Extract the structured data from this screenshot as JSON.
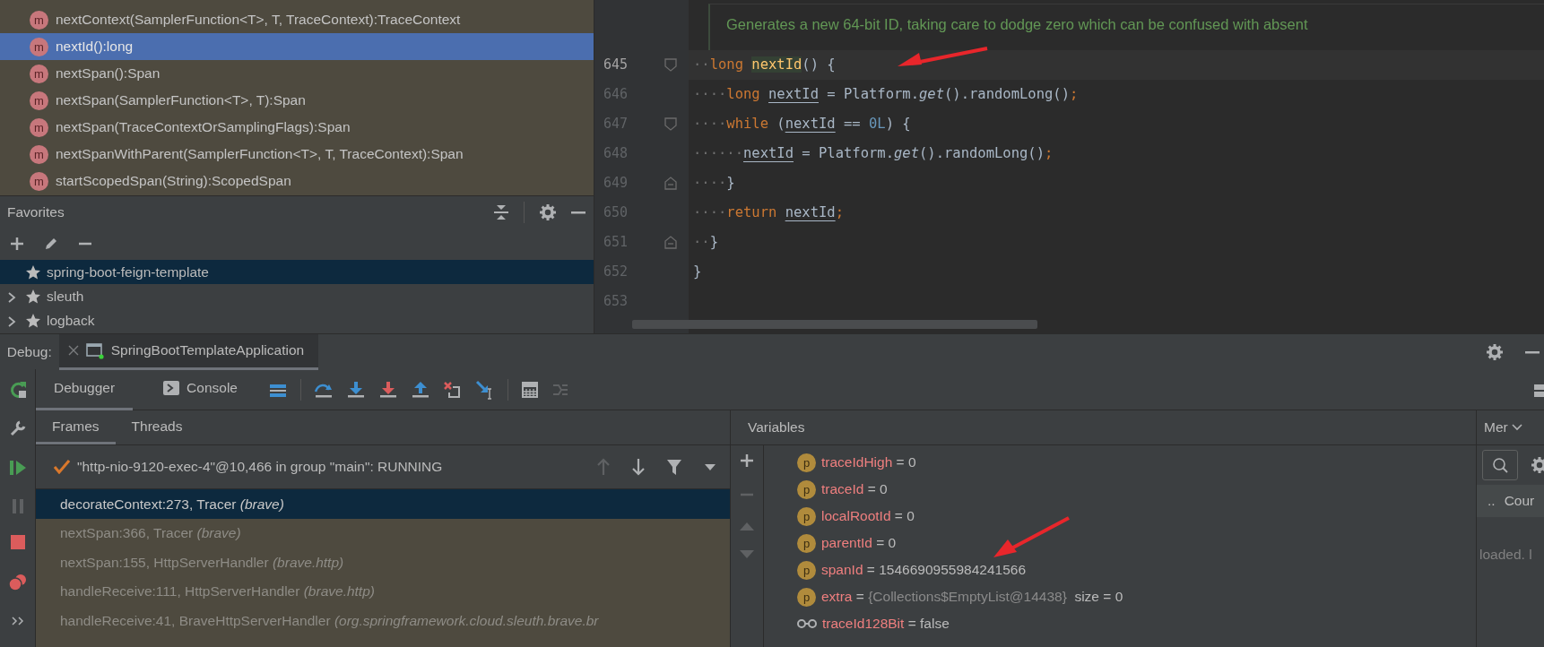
{
  "structure": {
    "items": [
      {
        "icon": "m",
        "label": "nextContext(SamplerFunction<T>, T, TraceContext):TraceContext",
        "selected": false
      },
      {
        "icon": "m",
        "label": "nextId():long",
        "selected": true
      },
      {
        "icon": "m",
        "label": "nextSpan():Span",
        "selected": false
      },
      {
        "icon": "m",
        "label": "nextSpan(SamplerFunction<T>, T):Span",
        "selected": false
      },
      {
        "icon": "m",
        "label": "nextSpan(TraceContextOrSamplingFlags):Span",
        "selected": false
      },
      {
        "icon": "m",
        "label": "nextSpanWithParent(SamplerFunction<T>, T, TraceContext):Span",
        "selected": false
      },
      {
        "icon": "m",
        "label": "startScopedSpan(String):ScopedSpan",
        "selected": false
      }
    ]
  },
  "favorites": {
    "title": "Favorites",
    "items": [
      {
        "label": "spring-boot-feign-template",
        "expandable": false,
        "selected": true
      },
      {
        "label": "sleuth",
        "expandable": true,
        "selected": false
      },
      {
        "label": "logback",
        "expandable": true,
        "selected": false
      }
    ]
  },
  "editor": {
    "doc_comment": "Generates a new 64-bit ID, taking care to dodge zero which can be confused with absent",
    "lines": [
      {
        "number": "645",
        "current": true,
        "fold_start": true,
        "fold_end": false,
        "tokens": [
          {
            "kind": "ws",
            "text": "··"
          },
          {
            "kind": "kw",
            "text": "long "
          },
          {
            "kind": "decl",
            "text": "nextId"
          },
          {
            "kind": "plain",
            "text": "() {"
          }
        ]
      },
      {
        "number": "646",
        "current": false,
        "fold_start": false,
        "fold_end": false,
        "tokens": [
          {
            "kind": "ws",
            "text": "····"
          },
          {
            "kind": "kw",
            "text": "long "
          },
          {
            "kind": "local",
            "text": "nextId"
          },
          {
            "kind": "plain",
            "text": " = Platform."
          },
          {
            "kind": "italic",
            "text": "get"
          },
          {
            "kind": "plain",
            "text": "().randomLong()"
          },
          {
            "kind": "kw",
            "text": ";"
          }
        ]
      },
      {
        "number": "647",
        "current": false,
        "fold_start": true,
        "fold_end": false,
        "tokens": [
          {
            "kind": "ws",
            "text": "····"
          },
          {
            "kind": "kw",
            "text": "while"
          },
          {
            "kind": "plain",
            "text": " ("
          },
          {
            "kind": "local",
            "text": "nextId"
          },
          {
            "kind": "plain",
            "text": " == "
          },
          {
            "kind": "num",
            "text": "0L"
          },
          {
            "kind": "plain",
            "text": ") {"
          }
        ]
      },
      {
        "number": "648",
        "current": false,
        "fold_start": false,
        "fold_end": false,
        "tokens": [
          {
            "kind": "ws",
            "text": "······"
          },
          {
            "kind": "local",
            "text": "nextId"
          },
          {
            "kind": "plain",
            "text": " = Platform."
          },
          {
            "kind": "italic",
            "text": "get"
          },
          {
            "kind": "plain",
            "text": "().randomLong()"
          },
          {
            "kind": "kw",
            "text": ";"
          }
        ]
      },
      {
        "number": "649",
        "current": false,
        "fold_start": false,
        "fold_end": true,
        "tokens": [
          {
            "kind": "ws",
            "text": "····"
          },
          {
            "kind": "plain",
            "text": "}"
          }
        ]
      },
      {
        "number": "650",
        "current": false,
        "fold_start": false,
        "fold_end": false,
        "tokens": [
          {
            "kind": "ws",
            "text": "····"
          },
          {
            "kind": "kw",
            "text": "return "
          },
          {
            "kind": "local",
            "text": "nextId"
          },
          {
            "kind": "kw",
            "text": ";"
          }
        ]
      },
      {
        "number": "651",
        "current": false,
        "fold_start": false,
        "fold_end": true,
        "tokens": [
          {
            "kind": "ws",
            "text": "··"
          },
          {
            "kind": "plain",
            "text": "}"
          }
        ]
      },
      {
        "number": "652",
        "current": false,
        "fold_start": false,
        "fold_end": false,
        "tokens": [
          {
            "kind": "plain",
            "text": "}"
          }
        ]
      },
      {
        "number": "653",
        "current": false,
        "fold_start": false,
        "fold_end": false
      }
    ]
  },
  "debug": {
    "label": "Debug:",
    "session_tab": "SpringBootTemplateApplication",
    "tabs": [
      {
        "label": "Debugger",
        "kind": "plain",
        "selected": true
      },
      {
        "label": "Console",
        "kind": "console",
        "selected": false
      }
    ],
    "panel_tabs": [
      {
        "label": "Frames",
        "selected": true
      },
      {
        "label": "Threads",
        "selected": false
      }
    ],
    "thread": "\"http-nio-9120-exec-4\"@10,466 in group \"main\": RUNNING",
    "frames": [
      {
        "location": "decorateContext:273, Tracer",
        "package": "(brave)",
        "selected": true
      },
      {
        "location": "nextSpan:366, Tracer",
        "package": "(brave)",
        "selected": false
      },
      {
        "location": "nextSpan:155, HttpServerHandler",
        "package": "(brave.http)",
        "selected": false
      },
      {
        "location": "handleReceive:111, HttpServerHandler",
        "package": "(brave.http)",
        "selected": false
      },
      {
        "location": "handleReceive:41, BraveHttpServerHandler",
        "package": "(org.springframework.cloud.sleuth.brave.br",
        "selected": false
      }
    ],
    "variables_title": "Variables",
    "variables": [
      {
        "kind": "field",
        "icon": "p",
        "name": "traceIdHigh",
        "equals": "=",
        "value": "0",
        "object": false
      },
      {
        "kind": "field",
        "icon": "p",
        "name": "traceId",
        "equals": "=",
        "value": "0",
        "object": false
      },
      {
        "kind": "field",
        "icon": "p",
        "name": "localRootId",
        "equals": "=",
        "value": "0",
        "object": false
      },
      {
        "kind": "field",
        "icon": "p",
        "name": "parentId",
        "equals": "=",
        "value": "0",
        "object": false
      },
      {
        "kind": "field",
        "icon": "p",
        "name": "spanId",
        "equals": "=",
        "value": "1546690955984241566",
        "object": false
      },
      {
        "kind": "field",
        "icon": "p",
        "name": "extra",
        "equals": "=",
        "value": "{Collections$EmptyList@14438}",
        "object": true,
        "note": "size = 0"
      },
      {
        "kind": "glasses",
        "name": "traceId128Bit",
        "equals": "=",
        "value": "false",
        "object": false
      }
    ],
    "memory": {
      "tab": "Mer",
      "ellipsis": "..",
      "column": "Cour",
      "status": "loaded. l"
    }
  }
}
